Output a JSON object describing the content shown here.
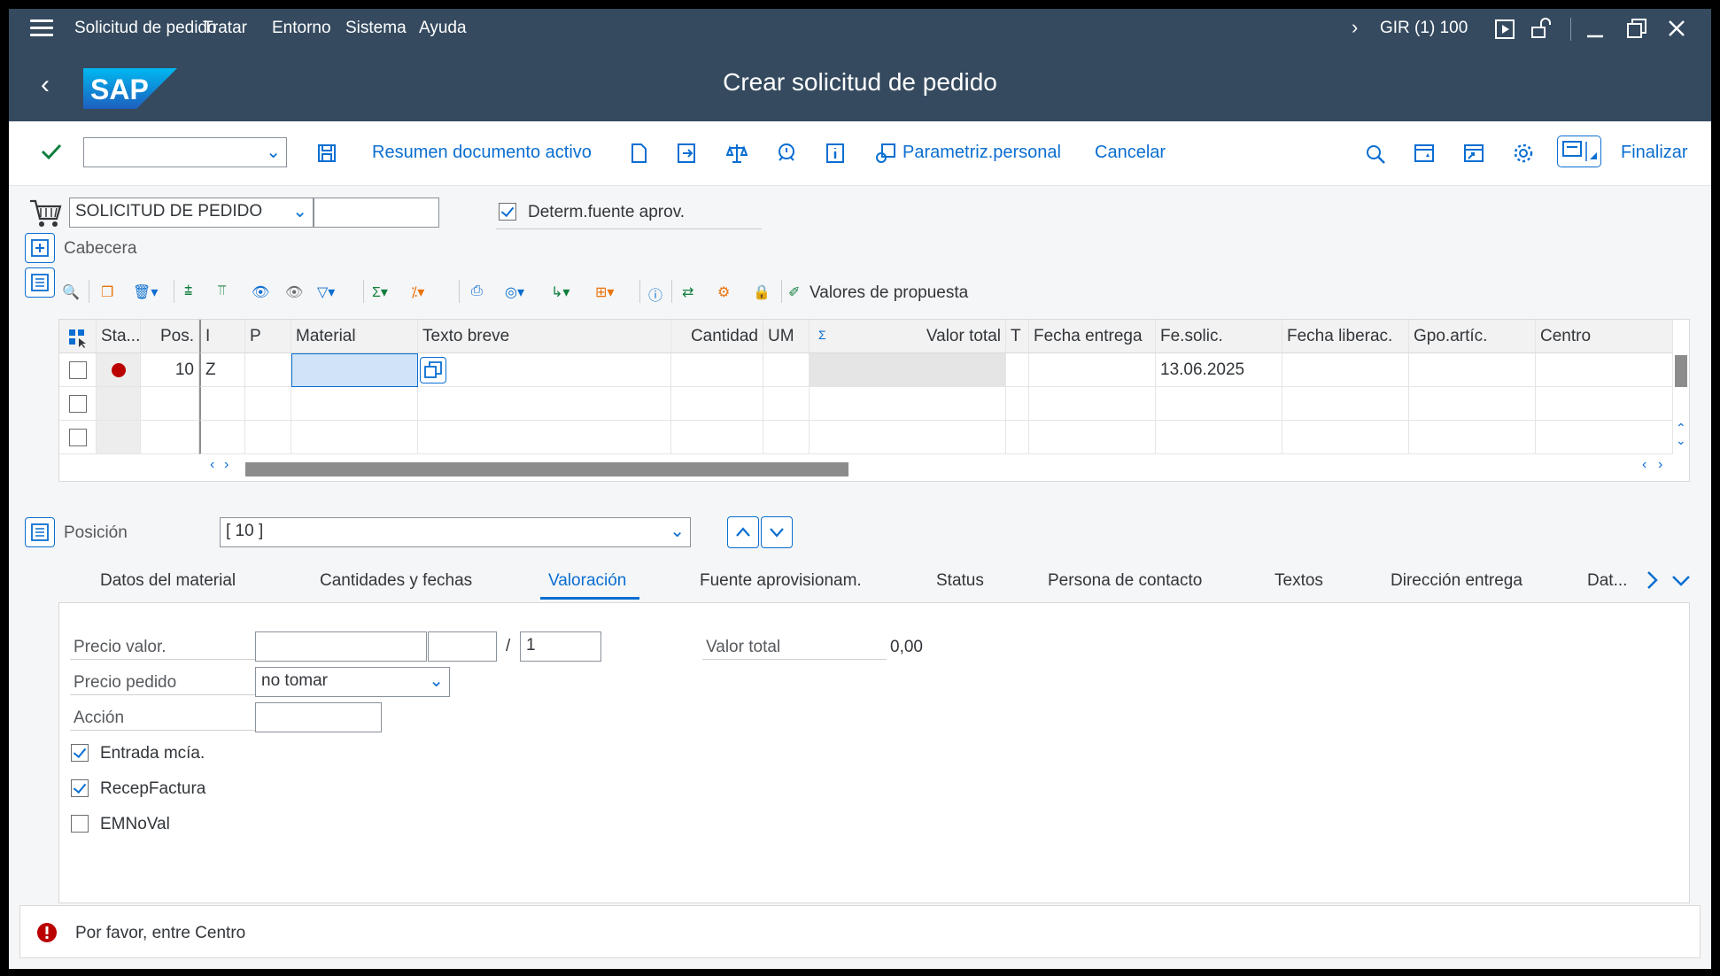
{
  "menu": {
    "items": [
      "Solicitud de pedido",
      "Tratar",
      "Entorno",
      "Sistema",
      "Ayuda"
    ],
    "system_info": "GIR (1) 100"
  },
  "titlebar": {
    "title": "Crear solicitud de pedido",
    "logo_text": "SAP"
  },
  "toolbar": {
    "summary_label": "Resumen documento activo",
    "personal_label": "Parametriz.personal",
    "cancel_label": "Cancelar",
    "finish_label": "Finalizar",
    "command_value": ""
  },
  "doc": {
    "doc_type": "SOLICITUD DE PEDIDO",
    "doc_number": "",
    "source_label": "Determ.fuente aprov.",
    "source_checked": true,
    "header_label": "Cabecera"
  },
  "grid_toolbar": {
    "proposal_label": "Valores de propuesta"
  },
  "grid": {
    "columns": [
      "Sta...",
      "Pos.",
      "I",
      "P",
      "Material",
      "Texto breve",
      "Cantidad",
      "UM",
      "Σ",
      "Valor total",
      "T",
      "Fecha entrega",
      "Fe.solic.",
      "Fecha liberac.",
      "Gpo.artíc.",
      "Centro"
    ],
    "rows": [
      {
        "status": "error",
        "pos": "10",
        "i": "Z",
        "p": "",
        "material": "",
        "text": "",
        "qty": "",
        "um": "",
        "total": "",
        "t": "",
        "delivery": "",
        "req_date": "13.06.2025",
        "release": "",
        "group": "",
        "plant": ""
      },
      {
        "status": "",
        "pos": "",
        "i": "",
        "p": "",
        "material": "",
        "text": "",
        "qty": "",
        "um": "",
        "total": "",
        "t": "",
        "delivery": "",
        "req_date": "",
        "release": "",
        "group": "",
        "plant": ""
      },
      {
        "status": "",
        "pos": "",
        "i": "",
        "p": "",
        "material": "",
        "text": "",
        "qty": "",
        "um": "",
        "total": "",
        "t": "",
        "delivery": "",
        "req_date": "",
        "release": "",
        "group": "",
        "plant": ""
      }
    ]
  },
  "item": {
    "label": "Posición",
    "selected": "[ 10 ]"
  },
  "tabs": [
    "Datos del material",
    "Cantidades y fechas",
    "Valoración",
    "Fuente aprovisionam.",
    "Status",
    "Persona de contacto",
    "Textos",
    "Dirección entrega",
    "Dat..."
  ],
  "active_tab": "Valoración",
  "valuation": {
    "price_label": "Precio valor.",
    "price_value": "",
    "currency_value": "",
    "per_separator": "/",
    "per_value": "1",
    "total_label": "Valor total",
    "total_value": "0,00",
    "order_price_label": "Precio pedido",
    "order_price_value": "no tomar",
    "action_label": "Acción",
    "action_value": "",
    "gr_label": "Entrada mcía.",
    "gr_checked": true,
    "ir_label": "RecepFactura",
    "ir_checked": true,
    "nonval_label": "EMNoVal",
    "nonval_checked": false
  },
  "status_bar": {
    "message": "Por favor, entre Centro",
    "type": "error"
  },
  "colors": {
    "shell": "#354a5f",
    "accent": "#0a6ed1",
    "error": "#bb0000",
    "success": "#107e3e"
  }
}
